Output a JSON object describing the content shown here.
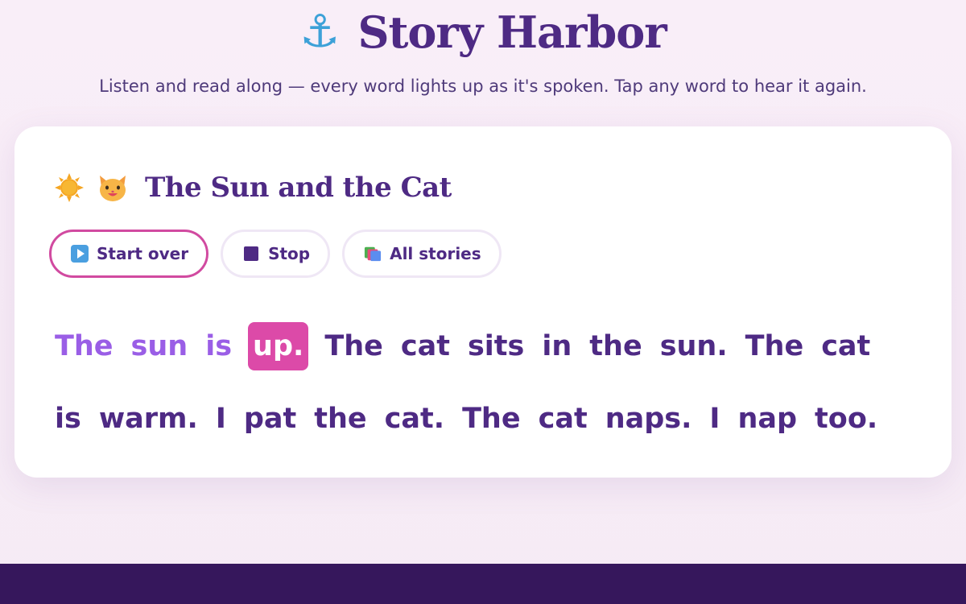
{
  "header": {
    "anchor_icon": "⚓",
    "title": "Story Harbor",
    "tagline": "Listen and read along — every word lights up as it's spoken. Tap any word to hear it again."
  },
  "story": {
    "icons": [
      "sun-icon",
      "cat-face-icon"
    ],
    "title": "The Sun and the Cat",
    "controls": {
      "start_over": "Start over",
      "stop": "Stop",
      "all_stories": "All stories"
    },
    "words": [
      {
        "text": "The",
        "state": "read"
      },
      {
        "text": "sun",
        "state": "read"
      },
      {
        "text": "is",
        "state": "read"
      },
      {
        "text": "up.",
        "state": "current"
      },
      {
        "text": "The",
        "state": "unread"
      },
      {
        "text": "cat",
        "state": "unread"
      },
      {
        "text": "sits",
        "state": "unread"
      },
      {
        "text": "in",
        "state": "unread"
      },
      {
        "text": "the",
        "state": "unread"
      },
      {
        "text": "sun.",
        "state": "unread"
      },
      {
        "text": "The",
        "state": "unread"
      },
      {
        "text": "cat",
        "state": "unread"
      },
      {
        "text": "is",
        "state": "unread"
      },
      {
        "text": "warm.",
        "state": "unread"
      },
      {
        "text": "I",
        "state": "unread"
      },
      {
        "text": "pat",
        "state": "unread"
      },
      {
        "text": "the",
        "state": "unread"
      },
      {
        "text": "cat.",
        "state": "unread"
      },
      {
        "text": "The",
        "state": "unread"
      },
      {
        "text": "cat",
        "state": "unread"
      },
      {
        "text": "naps.",
        "state": "unread"
      },
      {
        "text": "I",
        "state": "unread"
      },
      {
        "text": "nap",
        "state": "unread"
      },
      {
        "text": "too.",
        "state": "unread"
      }
    ]
  },
  "colors": {
    "brand": "#4e2a84",
    "read_word": "#9a5ee6",
    "current_word_bg": "#dc4aa8",
    "footer": "#36175c"
  }
}
